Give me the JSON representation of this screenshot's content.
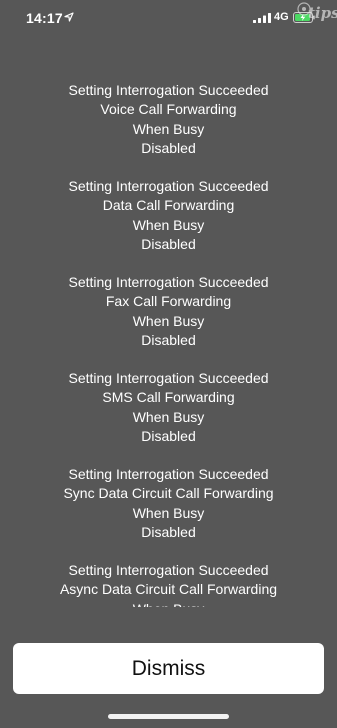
{
  "status_bar": {
    "time": "14:17",
    "network": "4G",
    "watermark_text": "tips"
  },
  "messages": [
    {
      "lines": [
        "Setting Interrogation Succeeded",
        "Voice Call Forwarding",
        "When Busy",
        "Disabled"
      ]
    },
    {
      "lines": [
        "Setting Interrogation Succeeded",
        "Data Call Forwarding",
        "When Busy",
        "Disabled"
      ]
    },
    {
      "lines": [
        "Setting Interrogation Succeeded",
        "Fax Call Forwarding",
        "When Busy",
        "Disabled"
      ]
    },
    {
      "lines": [
        "Setting Interrogation Succeeded",
        "SMS Call Forwarding",
        "When Busy",
        "Disabled"
      ]
    },
    {
      "lines": [
        "Setting Interrogation Succeeded",
        "Sync Data Circuit Call Forwarding",
        "When Busy",
        "Disabled"
      ]
    },
    {
      "lines": [
        "Setting Interrogation Succeeded",
        "Async Data Circuit Call Forwarding",
        "When Busy"
      ]
    }
  ],
  "dismiss_label": "Dismiss",
  "colors": {
    "background": "#575757",
    "button_background": "#ffffff",
    "text": "#ffffff",
    "battery_charging": "#4cd964"
  }
}
